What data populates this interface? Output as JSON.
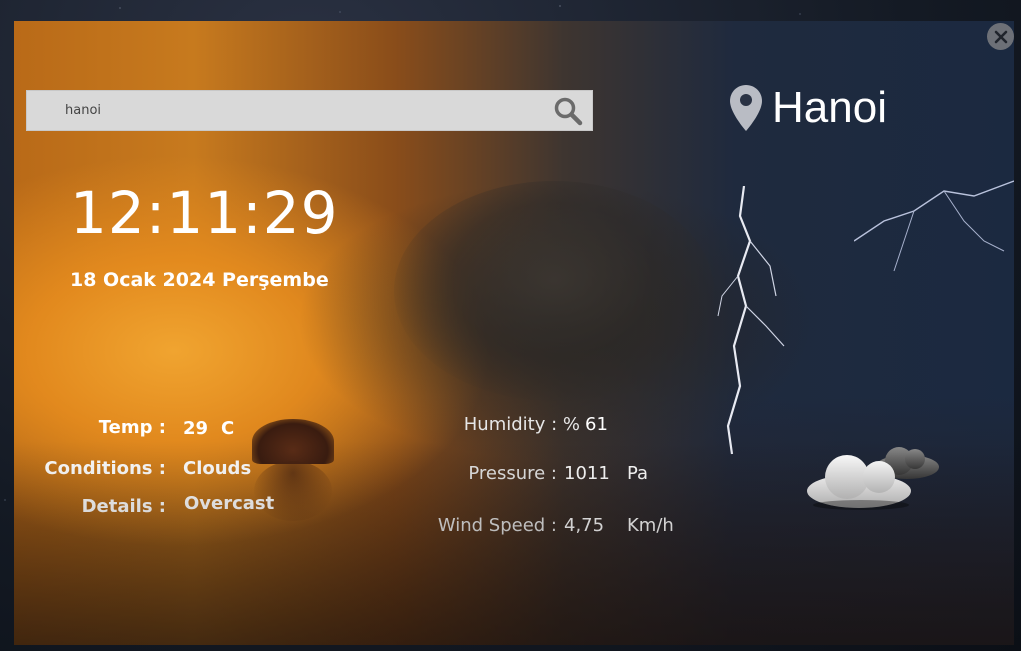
{
  "search": {
    "value": "hanoi",
    "placeholder": ""
  },
  "location": {
    "city": "Hanoi"
  },
  "time": {
    "clock": "12:11:29",
    "date": "18 Ocak 2024 Perşembe"
  },
  "weather": {
    "temp_label": "Temp :",
    "temp_value": "29",
    "temp_unit": "C",
    "conditions_label": "Conditions :",
    "conditions_value": "Clouds",
    "details_label": "Details :",
    "details_value": "Overcast",
    "humidity_label": "Humidity : %",
    "humidity_value": "61",
    "pressure_label": "Pressure :",
    "pressure_value": "1011",
    "pressure_unit": "Pa",
    "wind_label": "Wind Speed :",
    "wind_value": "4,75",
    "wind_unit": "Km/h",
    "icon": "clouds-icon"
  },
  "colors": {
    "search_bg": "#d9d9d9",
    "close_bg": "#6d7077",
    "text": "#ffffff"
  }
}
